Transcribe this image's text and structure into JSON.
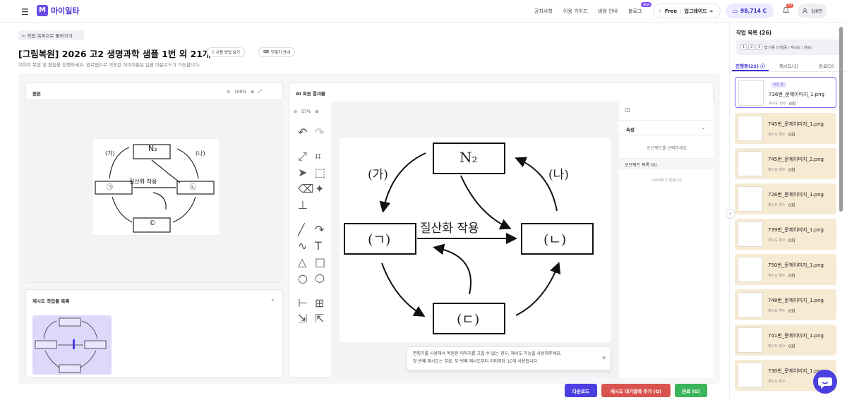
{
  "app": {
    "logo_text": "마이일타",
    "menu_icon": "hamburger-icon"
  },
  "nav": {
    "notices": "공지사항",
    "guide": "이용 가이드",
    "pricing": "비용 안내",
    "blog": "블로그",
    "new_badge": "NEW"
  },
  "plan": {
    "label": "Free",
    "upgrade": "업그레이드 →"
  },
  "credits": {
    "value": "98,714 C"
  },
  "notifications": {
    "count": "52"
  },
  "user": {
    "name": "김성민"
  },
  "page": {
    "back_label": "← 작업 목록으로 돌아가기",
    "title": "[그림복원] 2026 고2 생명과학 샘플 1번 외 21개",
    "howto_label": "사용 방법 보기",
    "shortcut_label": "단축키 안내",
    "subtitle": "이미지 복원 및 편집을 진행하세요. 완료탭으로 이동된 이미지들은 일괄 다운로드가 가능합니다."
  },
  "original": {
    "title": "원본",
    "zoom": "100%"
  },
  "redo": {
    "title": "재시도 작업물 목록"
  },
  "diagram": {
    "top": "N₂",
    "left": "(ㄱ)",
    "right": "(ㄴ)",
    "bottom": "(ㄷ)",
    "label_a": "(가)",
    "label_b": "(나)",
    "center": "질산화 작용",
    "sketch_top": "N₂",
    "sketch_left": "㉠",
    "sketch_right": "㉡",
    "sketch_bottom": "©"
  },
  "result": {
    "title": "AI 복원 결과물",
    "zoom": "57%"
  },
  "props": {
    "section": "속성",
    "hint": "오브젝트를 선택하세요",
    "objects_title": "오브젝트 목록 (0)",
    "objects_empty": "오브젝트가 없습니다"
  },
  "toast": {
    "line1": "편집기를 사용해서 복원된 이미지를 고칠 수 없는 경우, 재시도 기능을 사용해주세요.",
    "line2": "첫 번째 재시도는 무료, 두 번째 재시도부터 이미지당 1C이 사용됩니다."
  },
  "actions": {
    "download": "다운로드",
    "queue": "재시도 대기열에 추가 (Q)",
    "complete": "완료 (G)"
  },
  "sidebar": {
    "title": "작업 목록 (26)",
    "shortcut_keys": [
      "1",
      "2",
      "3"
    ],
    "shortcut_text": "탭 이동 (진행중 / 재시도 / 완료)",
    "tabs": [
      "진행중(22) ⓘ",
      "재시도(1)",
      "완료(3)"
    ],
    "viewing_badge": "보는 중",
    "retry_label": "재시도 횟수",
    "items": [
      {
        "name": "736번_문제이미지_1.png",
        "count": "0회"
      },
      {
        "name": "745번_문제이미지_1.png",
        "count": "0회"
      },
      {
        "name": "745번_문제이미지_2.png",
        "count": "0회"
      },
      {
        "name": "726번_문제이미지_1.png",
        "count": "0회"
      },
      {
        "name": "739번_문제이미지_1.png",
        "count": "0회"
      },
      {
        "name": "750번_문제이미지_1.png",
        "count": "0회"
      },
      {
        "name": "748번_문제이미지_1.png",
        "count": "0회"
      },
      {
        "name": "741번_문제이미지_1.png",
        "count": "0회"
      },
      {
        "name": "730번_문제이미지_1.png",
        "count": ""
      }
    ]
  },
  "colors": {
    "brand": "#4a2fd0",
    "download": "#4b3fe0",
    "queue": "#d9534f",
    "complete": "#3cb55a",
    "item_bg": "#f7ead3"
  }
}
